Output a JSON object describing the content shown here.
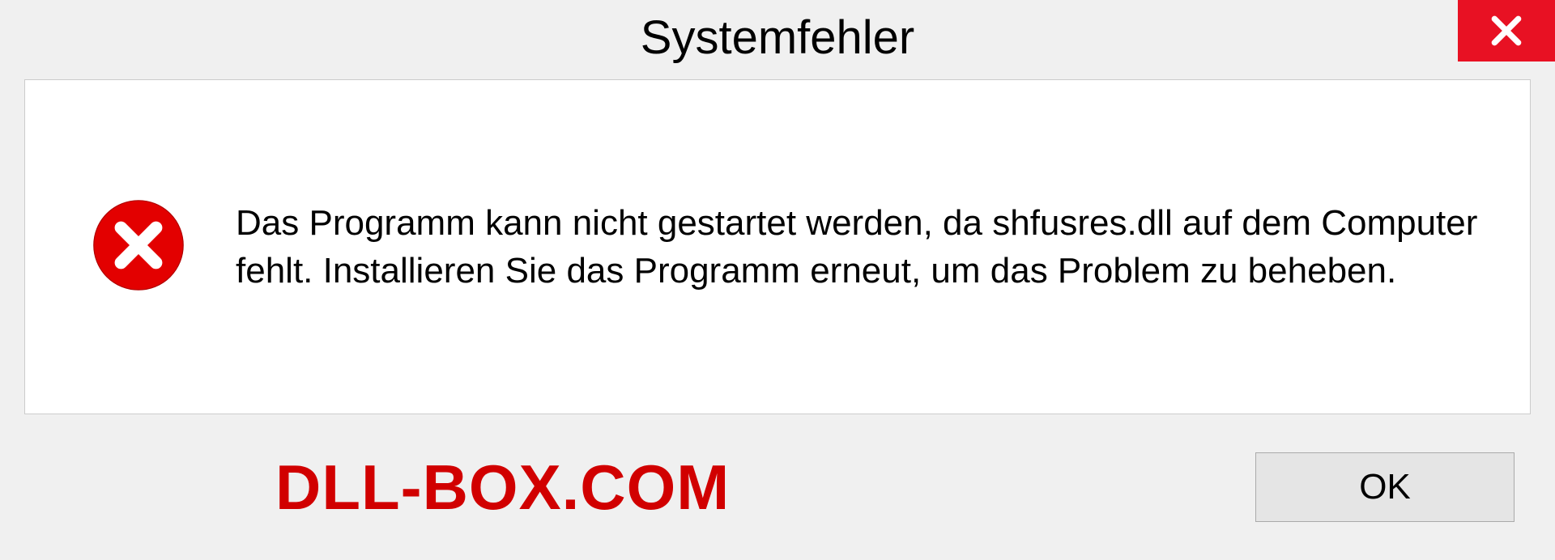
{
  "dialog": {
    "title": "Systemfehler",
    "message": "Das Programm kann nicht gestartet werden, da shfusres.dll auf dem Computer fehlt. Installieren Sie das Programm erneut, um das Problem zu beheben.",
    "ok_label": "OK"
  },
  "watermark": "DLL-BOX.COM"
}
